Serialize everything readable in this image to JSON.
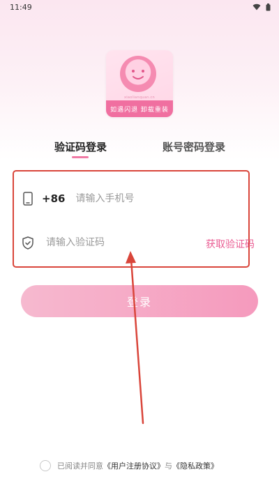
{
  "status_bar": {
    "time": "11:49",
    "icons": [
      "wifi-icon",
      "battery-icon"
    ]
  },
  "logo": {
    "url_text": "xiaolianquan.cn",
    "slogan": "如遇闪退 卸载重装"
  },
  "tabs": [
    {
      "label": "验证码登录",
      "active": true
    },
    {
      "label": "账号密码登录",
      "active": false
    }
  ],
  "phone": {
    "country_code": "+86",
    "placeholder": "请输入手机号",
    "icon": "phone-icon"
  },
  "code": {
    "placeholder": "请输入验证码",
    "icon": "shield-check-icon",
    "get_code_label": "获取验证码"
  },
  "login_button": {
    "label": "登录"
  },
  "agreement": {
    "prefix": "已阅读并同意",
    "user_agreement": "《用户注册协议》",
    "connector": "与",
    "privacy_policy": "《隐私政策》",
    "checked": false
  },
  "colors": {
    "accent": "#ea5d93",
    "highlight_border": "#d9453a",
    "button_gradient": [
      "#f6b9cf",
      "#f59abd"
    ]
  }
}
